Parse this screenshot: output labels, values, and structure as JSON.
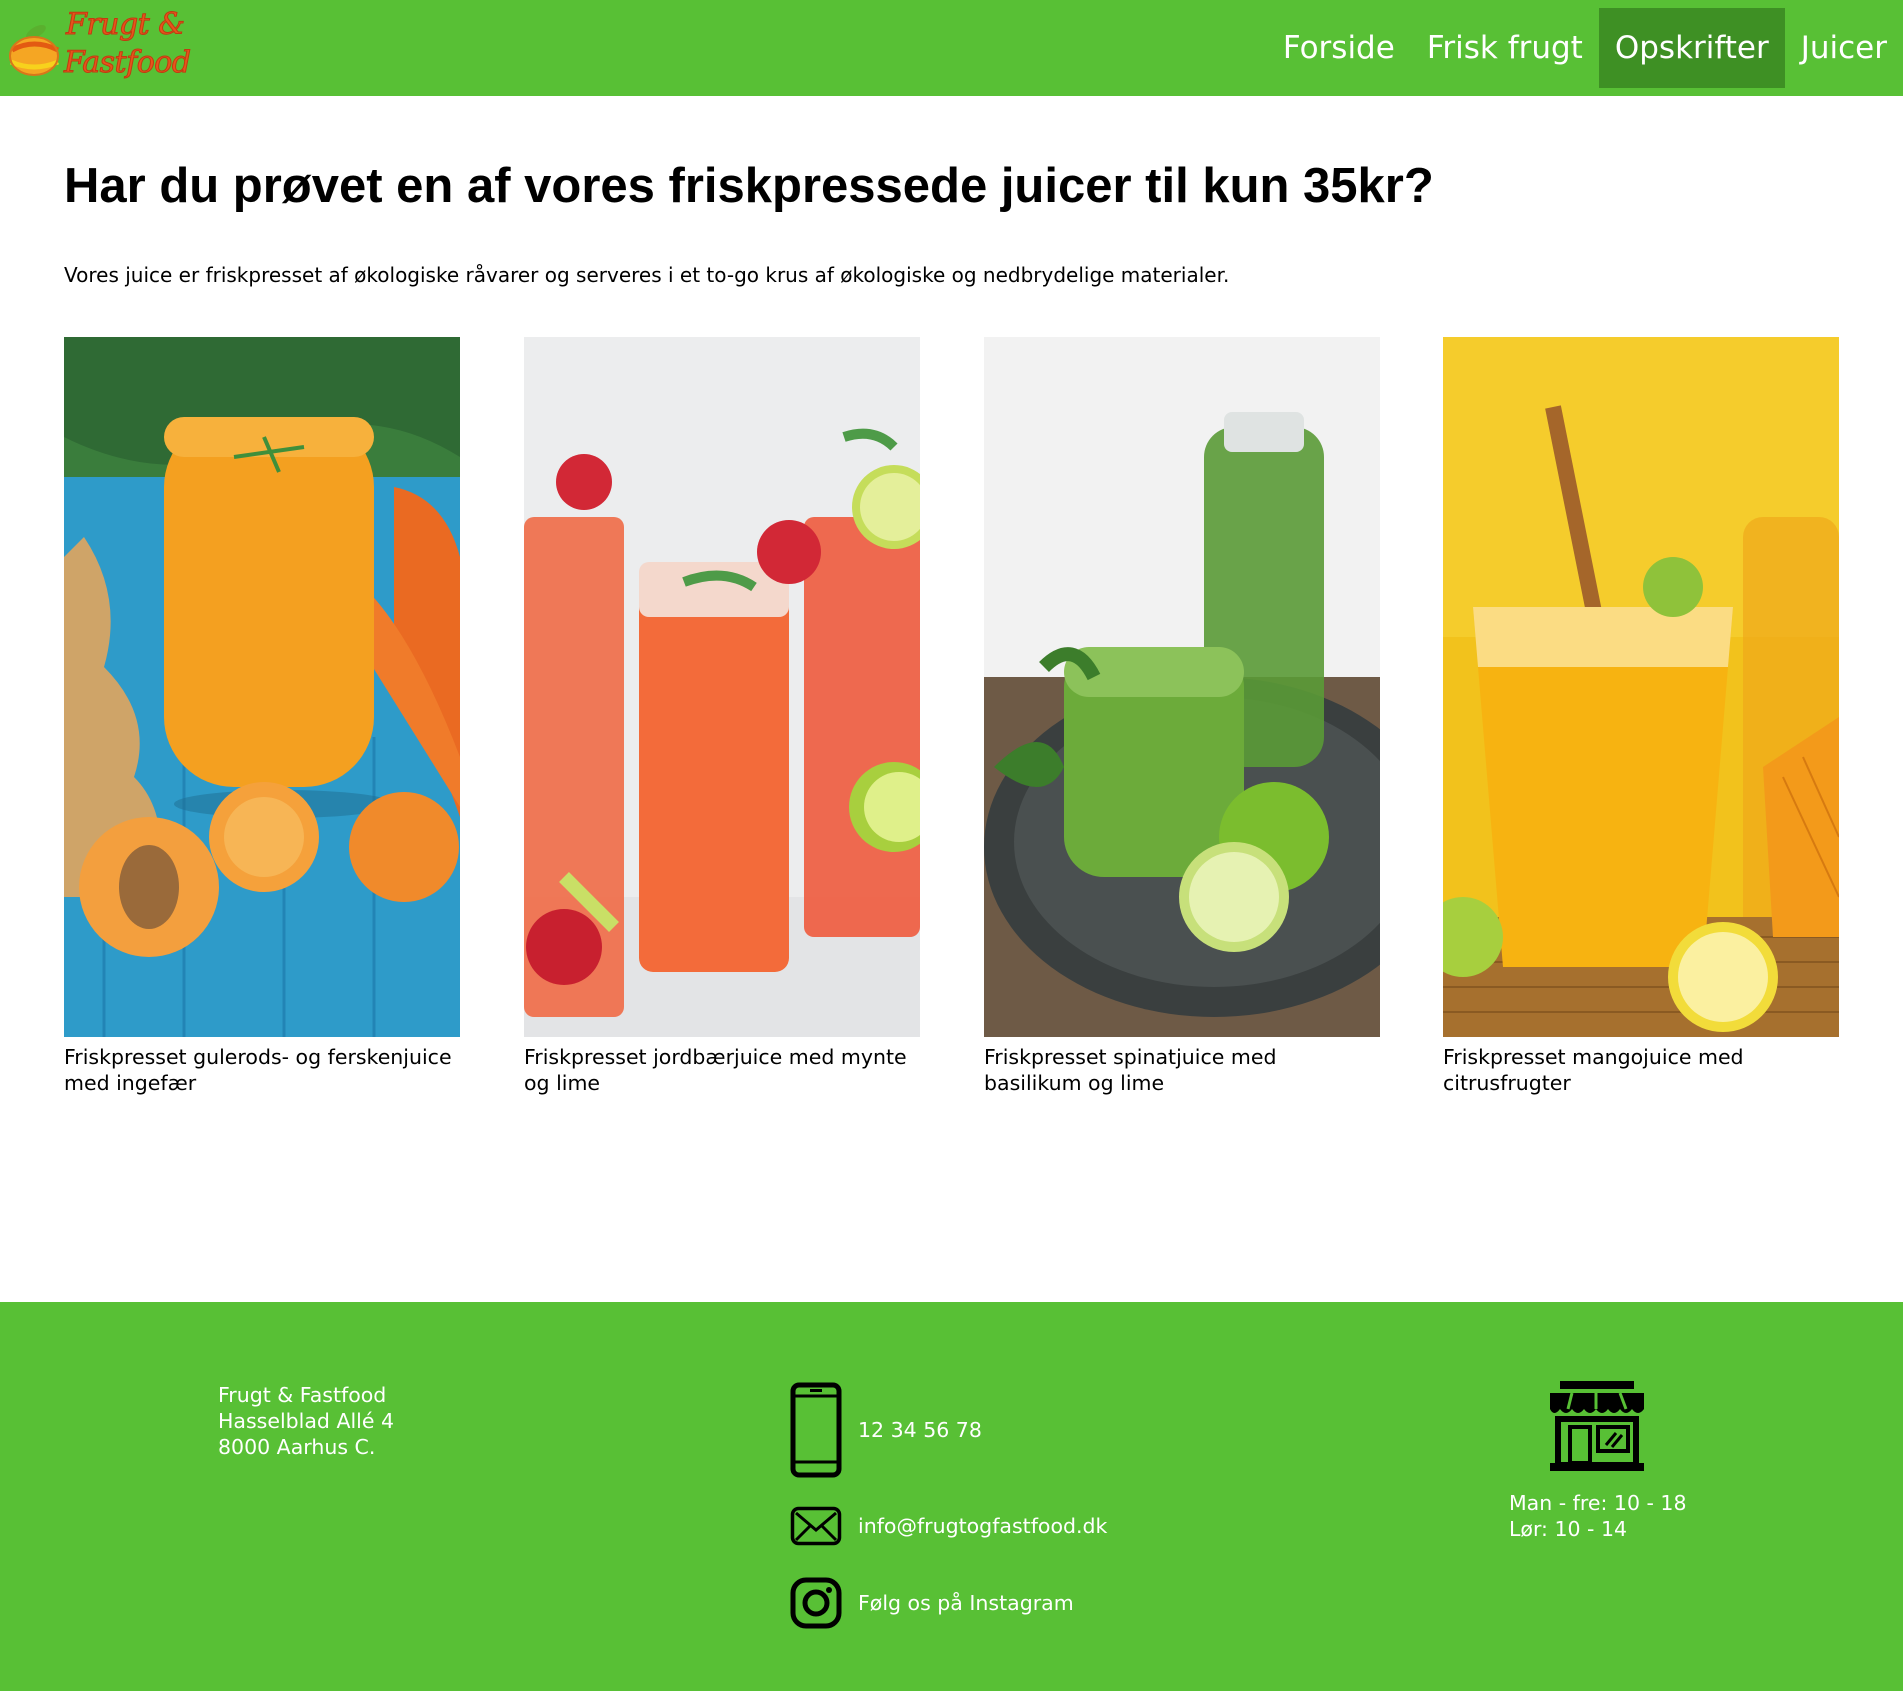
{
  "header": {
    "logo_line1": "Frugt &",
    "logo_line2": "Fastfood",
    "nav": [
      {
        "label": "Forside",
        "active": false
      },
      {
        "label": "Frisk frugt",
        "active": false
      },
      {
        "label": "Opskrifter",
        "active": true
      },
      {
        "label": "Juicer",
        "active": false
      }
    ]
  },
  "main": {
    "title": "Har du prøvet en af vores friskpressede juicer til kun 35kr?",
    "intro": "Vores juice er friskpresset af økologiske råvarer og serveres i et to-go krus af økologiske og nedbrydelige materialer.",
    "cards": [
      {
        "caption": "Friskpresset gulerods- og ferskenjuice med ingefær"
      },
      {
        "caption": "Friskpresset jordbærjuice med mynte og lime"
      },
      {
        "caption": "Friskpresset spinatjuice med basilikum og lime"
      },
      {
        "caption": "Friskpresset mangojuice med citrusfrugter"
      }
    ]
  },
  "footer": {
    "address": [
      "Frugt & Fastfood",
      "Hasselblad Allé 4",
      "8000 Aarhus C."
    ],
    "phone": "12 34 56 78",
    "email": "info@frugtogfastfood.dk",
    "instagram": "Følg os på Instagram",
    "hours": [
      "Man - fre: 10 - 18",
      "Lør: 10 - 14"
    ]
  },
  "colors": {
    "brand_green": "#58c035",
    "nav_active": "#3e9024",
    "logo_orange": "#e8541c"
  },
  "icons": [
    "orange-logo-icon",
    "phone-icon",
    "mail-icon",
    "instagram-icon",
    "shop-icon"
  ]
}
